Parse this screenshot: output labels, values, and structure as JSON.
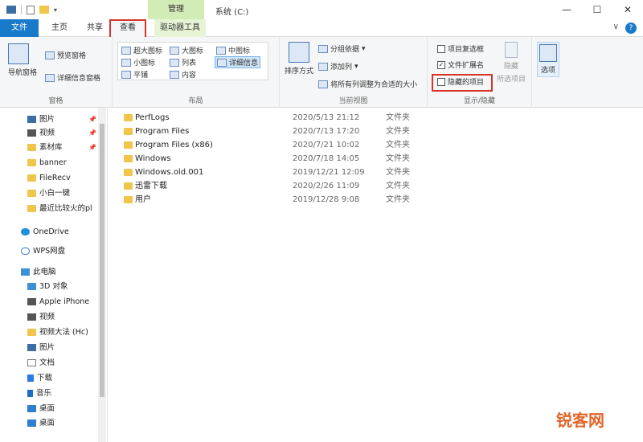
{
  "titlebar": {
    "manage_label": "管理",
    "window_title": "系统 (C:)",
    "minimize": "—",
    "maximize": "☐",
    "close": "✕"
  },
  "tabs": {
    "file": "文件",
    "home": "主页",
    "share": "共享",
    "view": "查看",
    "drive_tools": "驱动器工具"
  },
  "ribbon": {
    "panes": {
      "nav_pane": "导航窗格",
      "preview_pane": "预览窗格",
      "details_pane": "详细信息窗格",
      "label": "窗格"
    },
    "layout": {
      "extra_large": "超大图标",
      "large": "大图标",
      "medium": "中图标",
      "small": "小图标",
      "list": "列表",
      "details": "详细信息",
      "tiles": "平铺",
      "content": "内容",
      "label": "布局"
    },
    "current_view": {
      "sort_by": "排序方式",
      "group_by": "分组依据",
      "add_columns": "添加列",
      "size_all_columns": "将所有列调整为合适的大小",
      "label": "当前视图"
    },
    "show_hide": {
      "item_checkboxes": "项目复选框",
      "item_checkboxes_checked": false,
      "file_extensions": "文件扩展名",
      "file_extensions_checked": true,
      "hidden_items": "隐藏的项目",
      "hidden_items_checked": false,
      "hide_selected": "隐藏",
      "hide_selected_line2": "所选项目",
      "label": "显示/隐藏"
    },
    "options": "选项"
  },
  "nav": {
    "items": [
      {
        "label": "图片",
        "icon": "picture-icon",
        "pinned": true
      },
      {
        "label": "视频",
        "icon": "video-icon",
        "pinned": true
      },
      {
        "label": "素材库",
        "icon": "folder-icon",
        "pinned": true
      },
      {
        "label": "banner",
        "icon": "folder-icon",
        "pinned": false
      },
      {
        "label": "FileRecv",
        "icon": "folder-icon",
        "pinned": false
      },
      {
        "label": "小白一键",
        "icon": "folder-icon",
        "pinned": false
      },
      {
        "label": "最近比较火的pl",
        "icon": "folder-icon",
        "pinned": false
      },
      {
        "label": "OneDrive",
        "icon": "cloud-icon",
        "pinned": false
      },
      {
        "label": "WPS网盘",
        "icon": "wps-icon",
        "pinned": false
      },
      {
        "label": "此电脑",
        "icon": "pc-icon",
        "pinned": false
      },
      {
        "label": "3D 对象",
        "icon": "3d-icon",
        "pinned": false
      },
      {
        "label": "Apple iPhone",
        "icon": "phone-icon",
        "pinned": false
      },
      {
        "label": "视频",
        "icon": "video-icon",
        "pinned": false
      },
      {
        "label": "视频大法 (Hc)",
        "icon": "drive-icon",
        "pinned": false
      },
      {
        "label": "图片",
        "icon": "picture-icon",
        "pinned": false
      },
      {
        "label": "文档",
        "icon": "document-icon",
        "pinned": false
      },
      {
        "label": "下载",
        "icon": "download-icon",
        "pinned": false
      },
      {
        "label": "音乐",
        "icon": "music-icon",
        "pinned": false
      },
      {
        "label": "桌面",
        "icon": "desktop-icon",
        "pinned": false
      },
      {
        "label": "桌面",
        "icon": "desktop-icon",
        "pinned": false
      }
    ]
  },
  "files": [
    {
      "name": "PerfLogs",
      "date": "2020/5/13 21:12",
      "type": "文件夹"
    },
    {
      "name": "Program Files",
      "date": "2020/7/13 17:20",
      "type": "文件夹"
    },
    {
      "name": "Program Files (x86)",
      "date": "2020/7/21 10:02",
      "type": "文件夹"
    },
    {
      "name": "Windows",
      "date": "2020/7/18 14:05",
      "type": "文件夹"
    },
    {
      "name": "Windows.old.001",
      "date": "2019/12/21 12:09",
      "type": "文件夹"
    },
    {
      "name": "迅雷下载",
      "date": "2020/2/26 11:09",
      "type": "文件夹"
    },
    {
      "name": "用户",
      "date": "2019/12/28 9:08",
      "type": "文件夹"
    }
  ],
  "watermark": "锐客网",
  "colors": {
    "accent": "#1979ca",
    "highlight": "#d9342b",
    "manage_tab": "#d2ecb8",
    "folder": "#f1c549"
  }
}
